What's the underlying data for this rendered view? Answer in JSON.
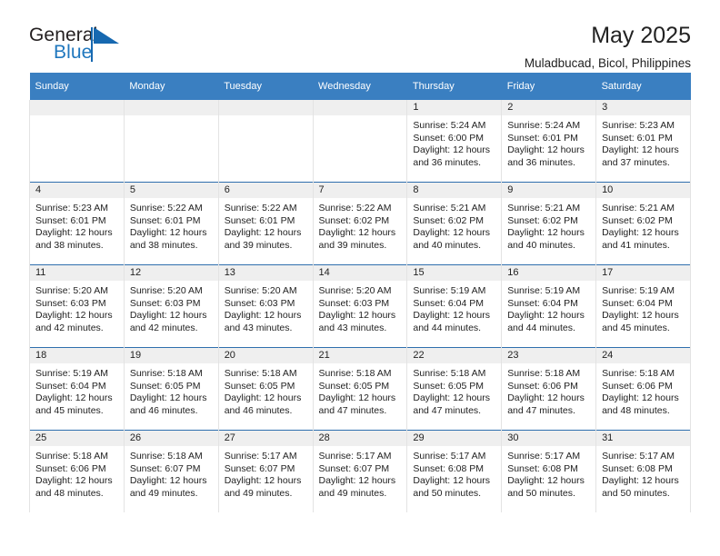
{
  "logo": {
    "word_one": "General",
    "word_two": "Blue",
    "accent_color": "#1668b0"
  },
  "header": {
    "title": "May 2025",
    "subtitle": "Muladbucad, Bicol, Philippines"
  },
  "calendar": {
    "header_bg": "#3a7fc1",
    "daynum_bg": "#efefef",
    "weekday_headers": [
      "Sunday",
      "Monday",
      "Tuesday",
      "Wednesday",
      "Thursday",
      "Friday",
      "Saturday"
    ],
    "weeks": [
      [
        {
          "day": "",
          "sunrise": "",
          "sunset": "",
          "daylight": "",
          "empty": true
        },
        {
          "day": "",
          "sunrise": "",
          "sunset": "",
          "daylight": "",
          "empty": true
        },
        {
          "day": "",
          "sunrise": "",
          "sunset": "",
          "daylight": "",
          "empty": true
        },
        {
          "day": "",
          "sunrise": "",
          "sunset": "",
          "daylight": "",
          "empty": true
        },
        {
          "day": "1",
          "sunrise": "Sunrise: 5:24 AM",
          "sunset": "Sunset: 6:00 PM",
          "daylight": "Daylight: 12 hours and 36 minutes.",
          "empty": false
        },
        {
          "day": "2",
          "sunrise": "Sunrise: 5:24 AM",
          "sunset": "Sunset: 6:01 PM",
          "daylight": "Daylight: 12 hours and 36 minutes.",
          "empty": false
        },
        {
          "day": "3",
          "sunrise": "Sunrise: 5:23 AM",
          "sunset": "Sunset: 6:01 PM",
          "daylight": "Daylight: 12 hours and 37 minutes.",
          "empty": false
        }
      ],
      [
        {
          "day": "4",
          "sunrise": "Sunrise: 5:23 AM",
          "sunset": "Sunset: 6:01 PM",
          "daylight": "Daylight: 12 hours and 38 minutes.",
          "empty": false
        },
        {
          "day": "5",
          "sunrise": "Sunrise: 5:22 AM",
          "sunset": "Sunset: 6:01 PM",
          "daylight": "Daylight: 12 hours and 38 minutes.",
          "empty": false
        },
        {
          "day": "6",
          "sunrise": "Sunrise: 5:22 AM",
          "sunset": "Sunset: 6:01 PM",
          "daylight": "Daylight: 12 hours and 39 minutes.",
          "empty": false
        },
        {
          "day": "7",
          "sunrise": "Sunrise: 5:22 AM",
          "sunset": "Sunset: 6:02 PM",
          "daylight": "Daylight: 12 hours and 39 minutes.",
          "empty": false
        },
        {
          "day": "8",
          "sunrise": "Sunrise: 5:21 AM",
          "sunset": "Sunset: 6:02 PM",
          "daylight": "Daylight: 12 hours and 40 minutes.",
          "empty": false
        },
        {
          "day": "9",
          "sunrise": "Sunrise: 5:21 AM",
          "sunset": "Sunset: 6:02 PM",
          "daylight": "Daylight: 12 hours and 40 minutes.",
          "empty": false
        },
        {
          "day": "10",
          "sunrise": "Sunrise: 5:21 AM",
          "sunset": "Sunset: 6:02 PM",
          "daylight": "Daylight: 12 hours and 41 minutes.",
          "empty": false
        }
      ],
      [
        {
          "day": "11",
          "sunrise": "Sunrise: 5:20 AM",
          "sunset": "Sunset: 6:03 PM",
          "daylight": "Daylight: 12 hours and 42 minutes.",
          "empty": false
        },
        {
          "day": "12",
          "sunrise": "Sunrise: 5:20 AM",
          "sunset": "Sunset: 6:03 PM",
          "daylight": "Daylight: 12 hours and 42 minutes.",
          "empty": false
        },
        {
          "day": "13",
          "sunrise": "Sunrise: 5:20 AM",
          "sunset": "Sunset: 6:03 PM",
          "daylight": "Daylight: 12 hours and 43 minutes.",
          "empty": false
        },
        {
          "day": "14",
          "sunrise": "Sunrise: 5:20 AM",
          "sunset": "Sunset: 6:03 PM",
          "daylight": "Daylight: 12 hours and 43 minutes.",
          "empty": false
        },
        {
          "day": "15",
          "sunrise": "Sunrise: 5:19 AM",
          "sunset": "Sunset: 6:04 PM",
          "daylight": "Daylight: 12 hours and 44 minutes.",
          "empty": false
        },
        {
          "day": "16",
          "sunrise": "Sunrise: 5:19 AM",
          "sunset": "Sunset: 6:04 PM",
          "daylight": "Daylight: 12 hours and 44 minutes.",
          "empty": false
        },
        {
          "day": "17",
          "sunrise": "Sunrise: 5:19 AM",
          "sunset": "Sunset: 6:04 PM",
          "daylight": "Daylight: 12 hours and 45 minutes.",
          "empty": false
        }
      ],
      [
        {
          "day": "18",
          "sunrise": "Sunrise: 5:19 AM",
          "sunset": "Sunset: 6:04 PM",
          "daylight": "Daylight: 12 hours and 45 minutes.",
          "empty": false
        },
        {
          "day": "19",
          "sunrise": "Sunrise: 5:18 AM",
          "sunset": "Sunset: 6:05 PM",
          "daylight": "Daylight: 12 hours and 46 minutes.",
          "empty": false
        },
        {
          "day": "20",
          "sunrise": "Sunrise: 5:18 AM",
          "sunset": "Sunset: 6:05 PM",
          "daylight": "Daylight: 12 hours and 46 minutes.",
          "empty": false
        },
        {
          "day": "21",
          "sunrise": "Sunrise: 5:18 AM",
          "sunset": "Sunset: 6:05 PM",
          "daylight": "Daylight: 12 hours and 47 minutes.",
          "empty": false
        },
        {
          "day": "22",
          "sunrise": "Sunrise: 5:18 AM",
          "sunset": "Sunset: 6:05 PM",
          "daylight": "Daylight: 12 hours and 47 minutes.",
          "empty": false
        },
        {
          "day": "23",
          "sunrise": "Sunrise: 5:18 AM",
          "sunset": "Sunset: 6:06 PM",
          "daylight": "Daylight: 12 hours and 47 minutes.",
          "empty": false
        },
        {
          "day": "24",
          "sunrise": "Sunrise: 5:18 AM",
          "sunset": "Sunset: 6:06 PM",
          "daylight": "Daylight: 12 hours and 48 minutes.",
          "empty": false
        }
      ],
      [
        {
          "day": "25",
          "sunrise": "Sunrise: 5:18 AM",
          "sunset": "Sunset: 6:06 PM",
          "daylight": "Daylight: 12 hours and 48 minutes.",
          "empty": false
        },
        {
          "day": "26",
          "sunrise": "Sunrise: 5:18 AM",
          "sunset": "Sunset: 6:07 PM",
          "daylight": "Daylight: 12 hours and 49 minutes.",
          "empty": false
        },
        {
          "day": "27",
          "sunrise": "Sunrise: 5:17 AM",
          "sunset": "Sunset: 6:07 PM",
          "daylight": "Daylight: 12 hours and 49 minutes.",
          "empty": false
        },
        {
          "day": "28",
          "sunrise": "Sunrise: 5:17 AM",
          "sunset": "Sunset: 6:07 PM",
          "daylight": "Daylight: 12 hours and 49 minutes.",
          "empty": false
        },
        {
          "day": "29",
          "sunrise": "Sunrise: 5:17 AM",
          "sunset": "Sunset: 6:08 PM",
          "daylight": "Daylight: 12 hours and 50 minutes.",
          "empty": false
        },
        {
          "day": "30",
          "sunrise": "Sunrise: 5:17 AM",
          "sunset": "Sunset: 6:08 PM",
          "daylight": "Daylight: 12 hours and 50 minutes.",
          "empty": false
        },
        {
          "day": "31",
          "sunrise": "Sunrise: 5:17 AM",
          "sunset": "Sunset: 6:08 PM",
          "daylight": "Daylight: 12 hours and 50 minutes.",
          "empty": false
        }
      ]
    ]
  }
}
